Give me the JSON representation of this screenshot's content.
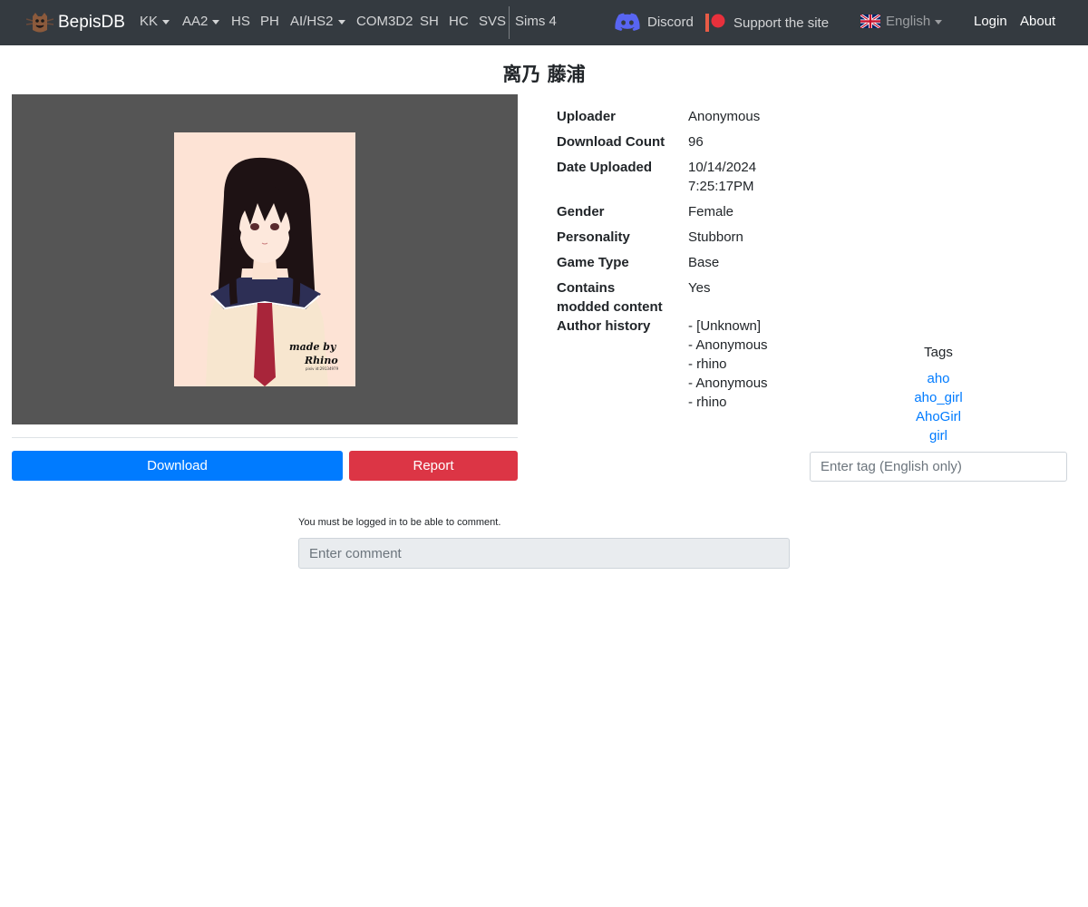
{
  "nav": {
    "brand": "BepisDB",
    "items": [
      {
        "label": "KK",
        "dropdown": true
      },
      {
        "label": "AA2",
        "dropdown": true
      },
      {
        "label": "HS",
        "dropdown": false
      },
      {
        "label": "PH",
        "dropdown": false
      },
      {
        "label": "AI/HS2",
        "dropdown": true
      },
      {
        "label": "COM3D2",
        "dropdown": false
      },
      {
        "label": "SH",
        "dropdown": false
      },
      {
        "label": "HC",
        "dropdown": false
      },
      {
        "label": "SVS",
        "dropdown": false
      },
      {
        "label": "Sims 4",
        "dropdown": false
      }
    ],
    "discord": "Discord",
    "support": "Support the site",
    "language": "English",
    "login": "Login",
    "about": "About"
  },
  "card": {
    "title": "离乃 藤浦",
    "watermark_line1": "made by",
    "watermark_line2": "Rhino",
    "watermark_line3": "pixiv id:29134979"
  },
  "actions": {
    "download": "Download",
    "report": "Report"
  },
  "info": {
    "uploader_label": "Uploader",
    "uploader": "Anonymous",
    "download_count_label": "Download Count",
    "download_count": "96",
    "date_label": "Date Uploaded",
    "date_line1": "10/14/2024",
    "date_line2": "7:25:17PM",
    "gender_label": "Gender",
    "gender": "Female",
    "personality_label": "Personality",
    "personality": "Stubborn",
    "game_type_label": "Game Type",
    "game_type": "Base",
    "modded_label_line1": "Contains",
    "modded_label_line2": "modded content",
    "modded": "Yes",
    "author_history_label": "Author history",
    "author_history": [
      "- [Unknown]",
      "- Anonymous",
      "- rhino",
      "- Anonymous",
      "- rhino"
    ]
  },
  "tags": {
    "heading": "Tags",
    "items": [
      "aho",
      "aho_girl",
      "AhoGirl",
      "girl"
    ],
    "input_placeholder": "Enter tag (English only)"
  },
  "comments": {
    "note": "You must be logged in to be able to comment.",
    "placeholder": "Enter comment"
  },
  "colors": {
    "navbar": "#343a40",
    "primary": "#007bff",
    "danger": "#dc3545",
    "preview_bg": "#555555"
  }
}
